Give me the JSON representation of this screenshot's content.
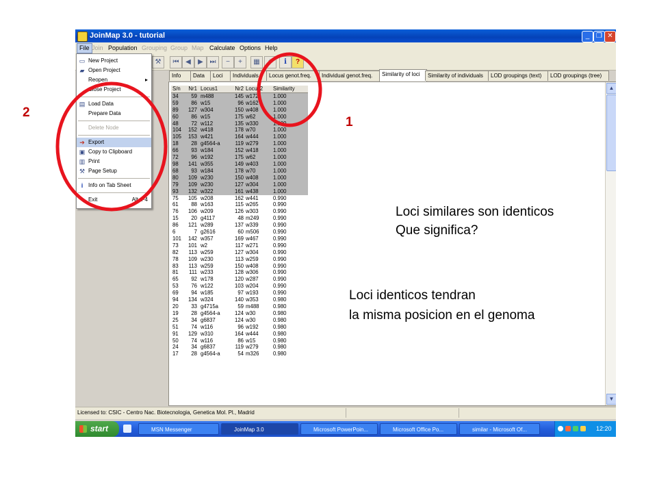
{
  "window": {
    "title": "JoinMap 3.0  -  tutorial",
    "controls": [
      "_",
      "❐",
      "✕"
    ]
  },
  "menubar": [
    {
      "label": "File",
      "enabled": true
    },
    {
      "label": "Join",
      "enabled": false
    },
    {
      "label": "Population",
      "enabled": true
    },
    {
      "label": "Grouping",
      "enabled": false
    },
    {
      "label": "Group",
      "enabled": false
    },
    {
      "label": "Map",
      "enabled": false
    },
    {
      "label": "Calculate",
      "enabled": true
    },
    {
      "label": "Options",
      "enabled": true
    },
    {
      "label": "Help",
      "enabled": true
    }
  ],
  "toolbar_icons": [
    "tools-icon",
    "first-icon",
    "prev-icon",
    "next-icon",
    "last-icon",
    "zoom-out-icon",
    "zoom-in-icon",
    "calculator-icon",
    "grid-icon",
    "info-icon",
    "help-icon"
  ],
  "tabs": [
    "Info",
    "Data",
    "Loci",
    "Individuals",
    "Locus genot.freq.",
    "Individual genot.freq.",
    "Similarity of loci",
    "Similarity of individuals",
    "LOD groupings (text)",
    "LOD groupings (tree)"
  ],
  "file_menu": {
    "items": [
      {
        "label": "New Project",
        "shortcut": "",
        "enabled": true,
        "icon": "new-project-icon"
      },
      {
        "label": "Open Project",
        "shortcut": "",
        "enabled": true,
        "icon": "open-folder-icon"
      },
      {
        "label": "Reopen",
        "shortcut": "▸",
        "enabled": true,
        "icon": ""
      },
      {
        "label": "Close Project",
        "shortcut": "",
        "enabled": true,
        "icon": ""
      },
      {
        "label": "Load Data",
        "shortcut": "",
        "enabled": true,
        "icon": "load-data-icon"
      },
      {
        "label": "Prepare Data",
        "shortcut": "",
        "enabled": true,
        "icon": ""
      },
      {
        "label": "Delete Node",
        "shortcut": "",
        "enabled": false,
        "icon": ""
      },
      {
        "label": "Export",
        "shortcut": "",
        "enabled": true,
        "icon": "export-icon",
        "highlight": true
      },
      {
        "label": "Copy to Clipboard",
        "shortcut": "",
        "enabled": true,
        "icon": "clipboard-icon"
      },
      {
        "label": "Print",
        "shortcut": "",
        "enabled": true,
        "icon": "print-icon"
      },
      {
        "label": "Page Setup",
        "shortcut": "",
        "enabled": true,
        "icon": "page-setup-icon"
      },
      {
        "label": "Info on Tab Sheet",
        "shortcut": "",
        "enabled": true,
        "icon": "info-icon"
      },
      {
        "label": "Exit",
        "shortcut": "Alt+F4",
        "enabled": true,
        "icon": ""
      }
    ]
  },
  "grid": {
    "headers": [
      "S/n",
      "Nr1",
      "Locus1",
      "Nr2",
      "Locus2",
      "Similarity"
    ],
    "rows": [
      [
        "34",
        "59",
        "m488",
        "145",
        "w172",
        "1.000"
      ],
      [
        "59",
        "86",
        "w15",
        "96",
        "w162",
        "1.000"
      ],
      [
        "89",
        "127",
        "w304",
        "150",
        "w408",
        "1.000"
      ],
      [
        "60",
        "86",
        "w15",
        "175",
        "w62",
        "1.000"
      ],
      [
        "48",
        "72",
        "w112",
        "135",
        "w330",
        "1.000"
      ],
      [
        "104",
        "152",
        "w418",
        "178",
        "w70",
        "1.000"
      ],
      [
        "105",
        "153",
        "w421",
        "164",
        "w444",
        "1.000"
      ],
      [
        "18",
        "28",
        "g4564-a",
        "119",
        "w279",
        "1.000"
      ],
      [
        "66",
        "93",
        "w184",
        "152",
        "w418",
        "1.000"
      ],
      [
        "72",
        "96",
        "w192",
        "175",
        "w62",
        "1.000"
      ],
      [
        "98",
        "141",
        "w355",
        "149",
        "w403",
        "1.000"
      ],
      [
        "68",
        "93",
        "w184",
        "178",
        "w70",
        "1.000"
      ],
      [
        "80",
        "109",
        "w230",
        "150",
        "w408",
        "1.000"
      ],
      [
        "79",
        "109",
        "w230",
        "127",
        "w304",
        "1.000"
      ],
      [
        "93",
        "132",
        "w322",
        "161",
        "w438",
        "1.000"
      ],
      [
        "75",
        "105",
        "w208",
        "162",
        "w441",
        "0.990"
      ],
      [
        "61",
        "88",
        "w163",
        "115",
        "w265",
        "0.990"
      ],
      [
        "76",
        "106",
        "w209",
        "126",
        "w303",
        "0.990"
      ],
      [
        "15",
        "20",
        "g4117",
        "48",
        "m249",
        "0.990"
      ],
      [
        "86",
        "121",
        "w289",
        "137",
        "w339",
        "0.990"
      ],
      [
        "6",
        "7",
        "g2616",
        "60",
        "m506",
        "0.990"
      ],
      [
        "101",
        "142",
        "w357",
        "169",
        "w467",
        "0.990"
      ],
      [
        "73",
        "101",
        "w2",
        "117",
        "w271",
        "0.990"
      ],
      [
        "82",
        "113",
        "w259",
        "127",
        "w304",
        "0.990"
      ],
      [
        "78",
        "109",
        "w230",
        "113",
        "w259",
        "0.990"
      ],
      [
        "83",
        "113",
        "w259",
        "150",
        "w408",
        "0.990"
      ],
      [
        "81",
        "111",
        "w233",
        "128",
        "w306",
        "0.990"
      ],
      [
        "65",
        "92",
        "w178",
        "120",
        "w287",
        "0.990"
      ],
      [
        "53",
        "76",
        "w122",
        "103",
        "w204",
        "0.990"
      ],
      [
        "69",
        "94",
        "w185",
        "97",
        "w193",
        "0.990"
      ],
      [
        "94",
        "134",
        "w324",
        "140",
        "w353",
        "0.980"
      ],
      [
        "20",
        "33",
        "g4715a",
        "59",
        "m488",
        "0.980"
      ],
      [
        "19",
        "28",
        "g4564-a",
        "124",
        "w30",
        "0.980"
      ],
      [
        "25",
        "34",
        "g6837",
        "124",
        "w30",
        "0.980"
      ],
      [
        "51",
        "74",
        "w116",
        "96",
        "w192",
        "0.980"
      ],
      [
        "91",
        "129",
        "w310",
        "164",
        "w444",
        "0.980"
      ],
      [
        "50",
        "74",
        "w116",
        "86",
        "w15",
        "0.980"
      ],
      [
        "24",
        "34",
        "g6837",
        "119",
        "w279",
        "0.980"
      ],
      [
        "17",
        "28",
        "g4564-a",
        "54",
        "m326",
        "0.980"
      ]
    ],
    "selected_row_count": 15
  },
  "statusbar": {
    "text": "Licensed to: CSIC - Centro Nac. Biotecnologia, Genetica Mol. Pl., Madrid"
  },
  "taskbar": {
    "start": "start",
    "items": [
      {
        "label": "MSN Messenger",
        "active": false
      },
      {
        "label": "JoinMap 3.0",
        "active": true
      },
      {
        "label": "Microsoft PowerPoin...",
        "active": false
      },
      {
        "label": "Microsoft Office Po...",
        "active": false
      },
      {
        "label": "similar - Microsoft Of...",
        "active": false
      }
    ],
    "clock": "12:20"
  },
  "annotations": {
    "label_1": "1",
    "label_2": "2",
    "question_line1": "Loci similares son identicos",
    "question_line2": "Que significa?",
    "answer_line1": "Loci identicos  tendran",
    "answer_line2": "la misma posicion en el genoma",
    "circle_color": "#e8141e"
  }
}
